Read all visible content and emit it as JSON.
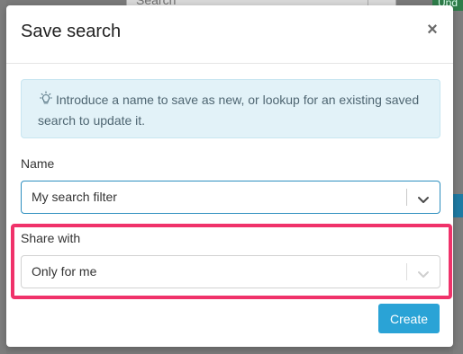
{
  "background": {
    "search_placeholder": "Search",
    "green_button_label": "Upd"
  },
  "modal": {
    "title": "Save search",
    "close_glyph": "×",
    "info_text": "Introduce a name to save as new, or lookup for an existing saved search to update it.",
    "name_label": "Name",
    "name_value": "My search filter",
    "share_label": "Share with",
    "share_value": "Only for me",
    "create_label": "Create"
  },
  "colors": {
    "accent": "#2aa3d6",
    "highlight": "#f0326a",
    "alert_bg": "#e2f2f8"
  },
  "icons": {
    "info": "lightbulb-icon",
    "close": "close-icon",
    "dropdown": "chevron-down-icon"
  }
}
